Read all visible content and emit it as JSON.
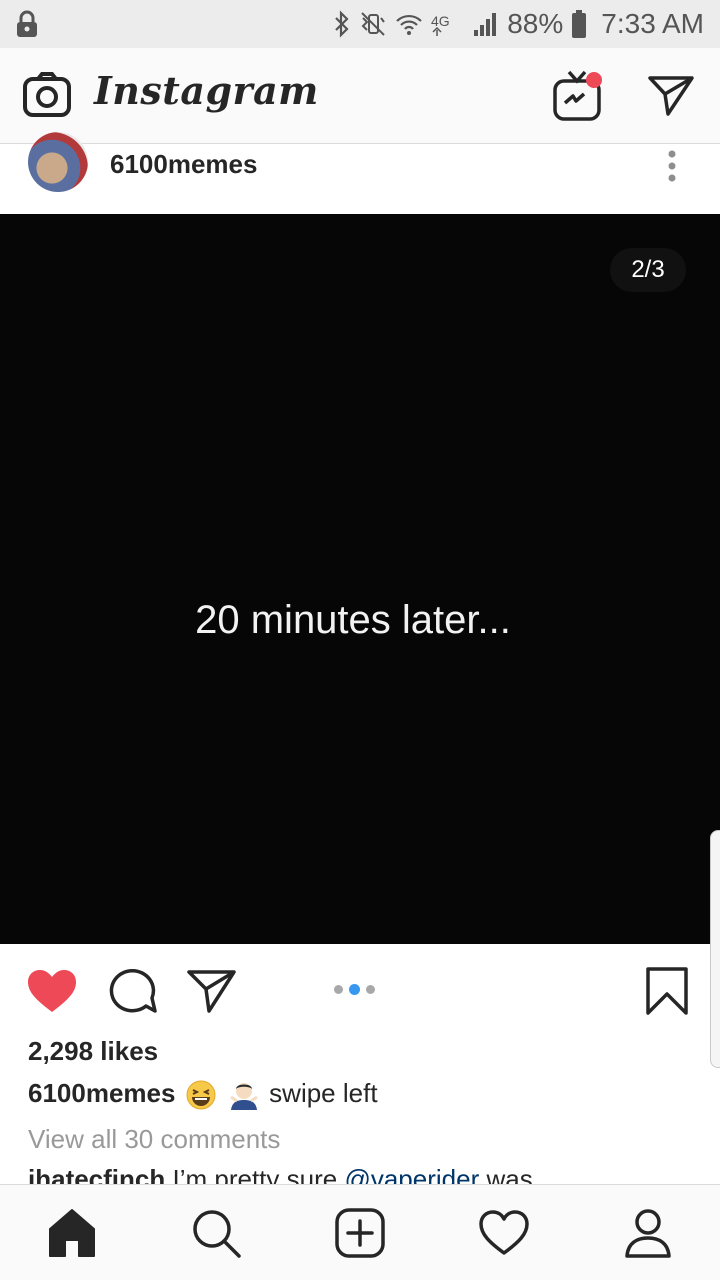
{
  "status_bar": {
    "battery_percent": "88%",
    "time": "7:33 AM",
    "network": "4G",
    "icons": [
      "lock-icon",
      "bluetooth-icon",
      "vibrate-icon",
      "wifi-icon",
      "signal-icon",
      "battery-icon"
    ]
  },
  "app_header": {
    "logo": "Instagram",
    "icons": [
      "camera-icon",
      "igtv-icon",
      "direct-message-icon"
    ],
    "notification_color": "#ed4956"
  },
  "post": {
    "username": "6100memes",
    "image_counter": "2/3",
    "image_text": "20 minutes later...",
    "carousel_pages": 3,
    "carousel_active_index": 2,
    "liked": true,
    "likes": "2,298 likes",
    "caption_user": "6100memes",
    "caption_text": "swipe left",
    "caption_emojis": [
      "laughing-emoji",
      "man-shrugging-emoji"
    ],
    "view_comments": "View all 30 comments",
    "comment_preview_user": "ihatecfinch",
    "comment_preview_text": "I’m pretty sure",
    "comment_preview_mention": "@vaperider",
    "comment_preview_rest": "was"
  },
  "colors": {
    "like_red": "#ed4956",
    "carousel_active": "#3897f0",
    "mention_blue": "#003569",
    "secondary_text": "#999999"
  },
  "bottom_nav": {
    "items": [
      "home-icon",
      "search-icon",
      "add-post-icon",
      "activity-heart-icon",
      "profile-icon"
    ],
    "active": "home-icon"
  }
}
